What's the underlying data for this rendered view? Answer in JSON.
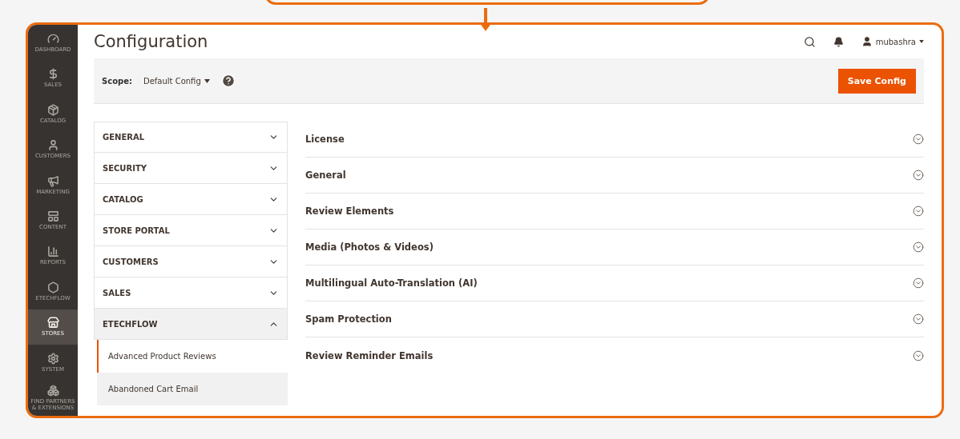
{
  "sidebar": {
    "items": [
      {
        "label": "DASHBOARD",
        "kind": "dashboard",
        "selected": false
      },
      {
        "label": "SALES",
        "kind": "sales",
        "selected": false
      },
      {
        "label": "CATALOG",
        "kind": "catalog",
        "selected": false
      },
      {
        "label": "CUSTOMERS",
        "kind": "customers",
        "selected": false
      },
      {
        "label": "MARKETING",
        "kind": "marketing",
        "selected": false
      },
      {
        "label": "CONTENT",
        "kind": "content",
        "selected": false
      },
      {
        "label": "REPORTS",
        "kind": "reports",
        "selected": false
      },
      {
        "label": "ETECHFLOW",
        "kind": "extension",
        "selected": false
      },
      {
        "label": "STORES",
        "kind": "stores",
        "selected": true
      },
      {
        "label": "SYSTEM",
        "kind": "system",
        "selected": false
      },
      {
        "label": "FIND PARTNERS & EXTENSIONS",
        "kind": "partners",
        "selected": false
      }
    ]
  },
  "header": {
    "title": "Configuration",
    "user": "mubashra"
  },
  "scope": {
    "label": "Scope:",
    "value": "Default Config",
    "button": "Save Config"
  },
  "config_nav": [
    {
      "label": "GENERAL",
      "expanded": false
    },
    {
      "label": "SECURITY",
      "expanded": false
    },
    {
      "label": "CATALOG",
      "expanded": false
    },
    {
      "label": "STORE PORTAL",
      "expanded": false
    },
    {
      "label": "CUSTOMERS",
      "expanded": false
    },
    {
      "label": "SALES",
      "expanded": false
    },
    {
      "label": "ETECHFLOW",
      "expanded": true,
      "children": [
        {
          "label": "Advanced Product Reviews",
          "selected": true
        },
        {
          "label": "Abandoned Cart Email",
          "selected": false
        }
      ]
    }
  ],
  "sections": [
    {
      "label": "License",
      "expanded": false
    },
    {
      "label": "General",
      "expanded": false
    },
    {
      "label": "Review Elements",
      "expanded": false
    },
    {
      "label": "Media (Photos & Videos)",
      "expanded": false
    },
    {
      "label": "Multilingual Auto-Translation (AI)",
      "expanded": false
    },
    {
      "label": "Spam Protection",
      "expanded": false
    },
    {
      "label": "Review Reminder Emails",
      "expanded": false
    }
  ]
}
